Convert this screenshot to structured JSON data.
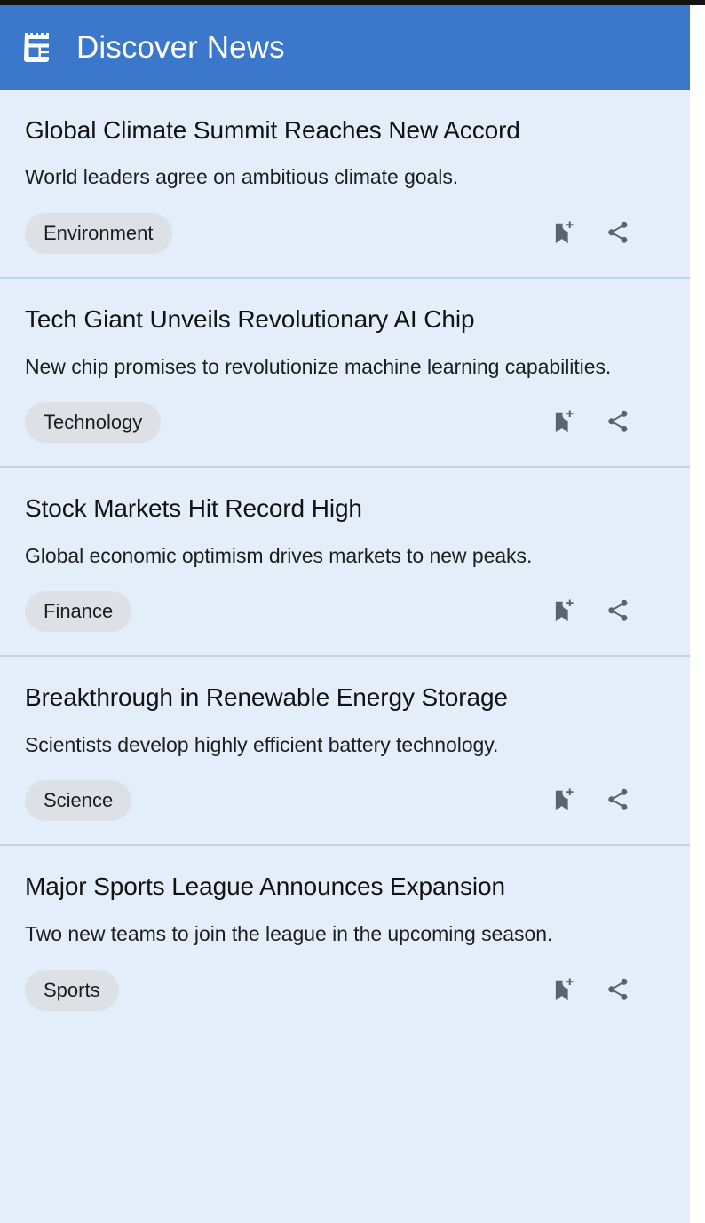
{
  "app": {
    "title": "Discover News",
    "icon": "news-article-icon",
    "header_color": "#3b78cc",
    "header_text_color": "#ffffff",
    "background_color": "#e3eefa",
    "chip_color": "#dde1e6",
    "icon_color": "#5a6470",
    "divider_color": "#c2d3e4"
  },
  "actions": {
    "bookmark": "bookmark-add-icon",
    "share": "share-icon"
  },
  "feed": {
    "articles": [
      {
        "title": "Global Climate Summit Reaches New Accord",
        "description": "World leaders agree on ambitious climate goals.",
        "category": "Environment"
      },
      {
        "title": "Tech Giant Unveils Revolutionary AI Chip",
        "description": "New chip promises to revolutionize machine learning capabilities.",
        "category": "Technology"
      },
      {
        "title": "Stock Markets Hit Record High",
        "description": "Global economic optimism drives markets to new peaks.",
        "category": "Finance"
      },
      {
        "title": "Breakthrough in Renewable Energy Storage",
        "description": "Scientists develop highly efficient battery technology.",
        "category": "Science"
      },
      {
        "title": "Major Sports League Announces Expansion",
        "description": "Two new teams to join the league in the upcoming season.",
        "category": "Sports"
      }
    ]
  }
}
